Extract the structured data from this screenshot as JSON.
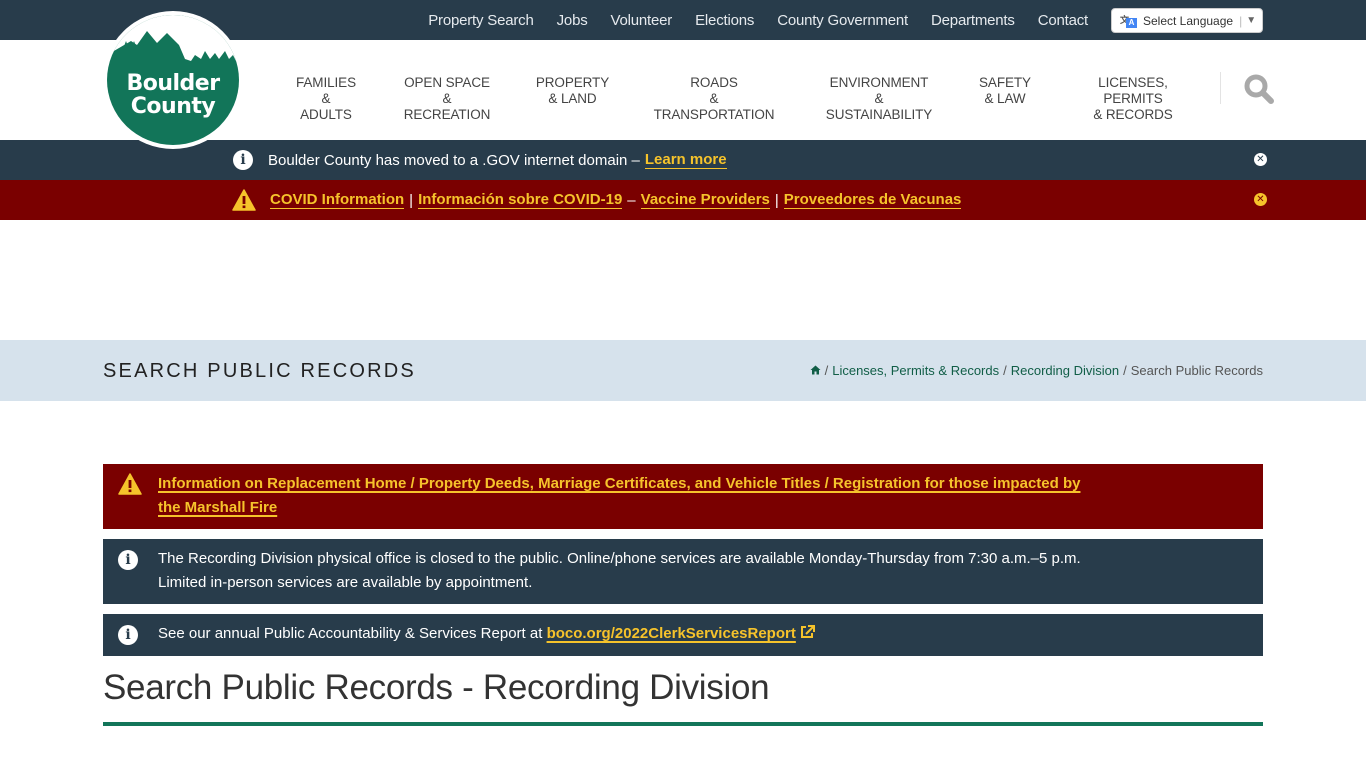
{
  "utility_nav": {
    "links": [
      "Property Search",
      "Jobs",
      "Volunteer",
      "Elections",
      "County Government",
      "Departments",
      "Contact"
    ],
    "language_select": {
      "label": "Select Language",
      "icon": "google-translate-icon"
    }
  },
  "logo": {
    "line1": "Boulder",
    "line2": "County"
  },
  "main_nav": {
    "items": [
      {
        "line1": "FAMILIES",
        "line2": "& ADULTS"
      },
      {
        "line1": "OPEN SPACE",
        "line2": "& RECREATION"
      },
      {
        "line1": "PROPERTY",
        "line2": "& LAND"
      },
      {
        "line1": "ROADS",
        "line2": "& TRANSPORTATION"
      },
      {
        "line1": "ENVIRONMENT",
        "line2": "& SUSTAINABILITY"
      },
      {
        "line1": "SAFETY",
        "line2": "& LAW"
      },
      {
        "line1": "LICENSES, PERMITS",
        "line2": "& RECORDS"
      }
    ],
    "search_icon": "search-icon"
  },
  "alerts": {
    "gov": {
      "text": "Boulder County has moved to a .GOV internet domain –",
      "link": "Learn more"
    },
    "covid": {
      "links": [
        "COVID Information",
        "Información sobre COVID-19",
        "Vaccine Providers",
        "Proveedores de Vacunas"
      ],
      "separators": [
        "|",
        "–",
        "|"
      ]
    }
  },
  "title_band": {
    "title": "SEARCH PUBLIC RECORDS",
    "breadcrumb": [
      "Licenses, Permits & Records",
      "Recording Division",
      "Search Public Records"
    ],
    "separator": "/"
  },
  "notices": {
    "marshall_fire": "Information on Replacement Home / Property Deeds, Marriage Certificates, and Vehicle Titles / Registration for those impacted by the Marshall Fire",
    "office_closed": "The Recording Division physical office is closed to the public. Online/phone services are available Monday-Thursday from 7:30 a.m.–5 p.m. Limited in-person services are available by appointment.",
    "report": {
      "text": "See our annual Public Accountability & Services Report at ",
      "link": "boco.org/2022ClerkServicesReport"
    }
  },
  "page_heading": "Search Public Records - Recording Division",
  "colors": {
    "dark_navy": "#283c4b",
    "alert_red": "#7a0000",
    "link_yellow": "#f6c32b",
    "brand_green": "#127559",
    "title_band_bg": "#d6e2ec"
  }
}
